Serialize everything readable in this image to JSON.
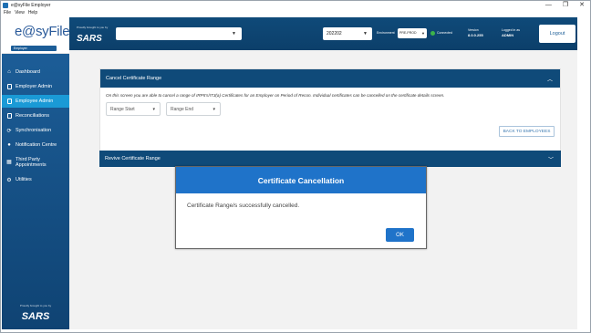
{
  "window": {
    "title": "e@syFile Employer",
    "controls": {
      "minimize": "—",
      "maximize": "❐",
      "close": "✕"
    }
  },
  "menu": [
    "File",
    "View",
    "Help"
  ],
  "logo": {
    "text": "e@syFile",
    "tag": "Employer"
  },
  "header": {
    "sars_tagline": "Proudly brought to you by",
    "sars_name": "SARS",
    "employer_value": "",
    "period_value": "202202",
    "environment_label": "Environment",
    "environment_value": "PRE-PROD",
    "connection_status": "Connected",
    "version_label": "Version",
    "version_value": "8.0.0.255",
    "logged_in_label": "Logged in as",
    "logged_in_value": "ADMIN",
    "logout_label": "Logout"
  },
  "sidebar": {
    "items": [
      {
        "label": "Dashboard",
        "icon": "home-icon"
      },
      {
        "label": "Employer Admin",
        "icon": "document-icon"
      },
      {
        "label": "Employee Admin",
        "icon": "document-icon",
        "active": true
      },
      {
        "label": "Reconciliations",
        "icon": "reconcile-icon"
      },
      {
        "label": "Synchronisation",
        "icon": "sync-icon"
      },
      {
        "label": "Notification Centre",
        "icon": "bell-icon"
      },
      {
        "label": "Third Party Appointments",
        "icon": "calendar-icon"
      },
      {
        "label": "Utilities",
        "icon": "tools-icon"
      }
    ],
    "footer_tagline": "Proudly brought to you by",
    "footer_name": "SARS"
  },
  "cancel_panel": {
    "title": "Cancel Certificate Range",
    "description": "On this screen you are able to cancel a range of IRP5's/IT3(a) Certificates for an Employer on Period of Recon. Individual certificates can be cancelled on the certificate details screen.",
    "range_start_placeholder": "Range Start",
    "range_end_placeholder": "Range End",
    "back_button": "BACK TO EMPLOYEES"
  },
  "revive_panel": {
    "title": "Revive Certificate Range"
  },
  "dialog": {
    "title": "Certificate Cancellation",
    "message": "Certificate Range/s successfully cancelled.",
    "ok_label": "OK"
  },
  "colors": {
    "primary": "#0f4a79",
    "active_nav": "#1a9ad6",
    "dialog_blue": "#1f73c9",
    "connected": "#3db34a"
  }
}
